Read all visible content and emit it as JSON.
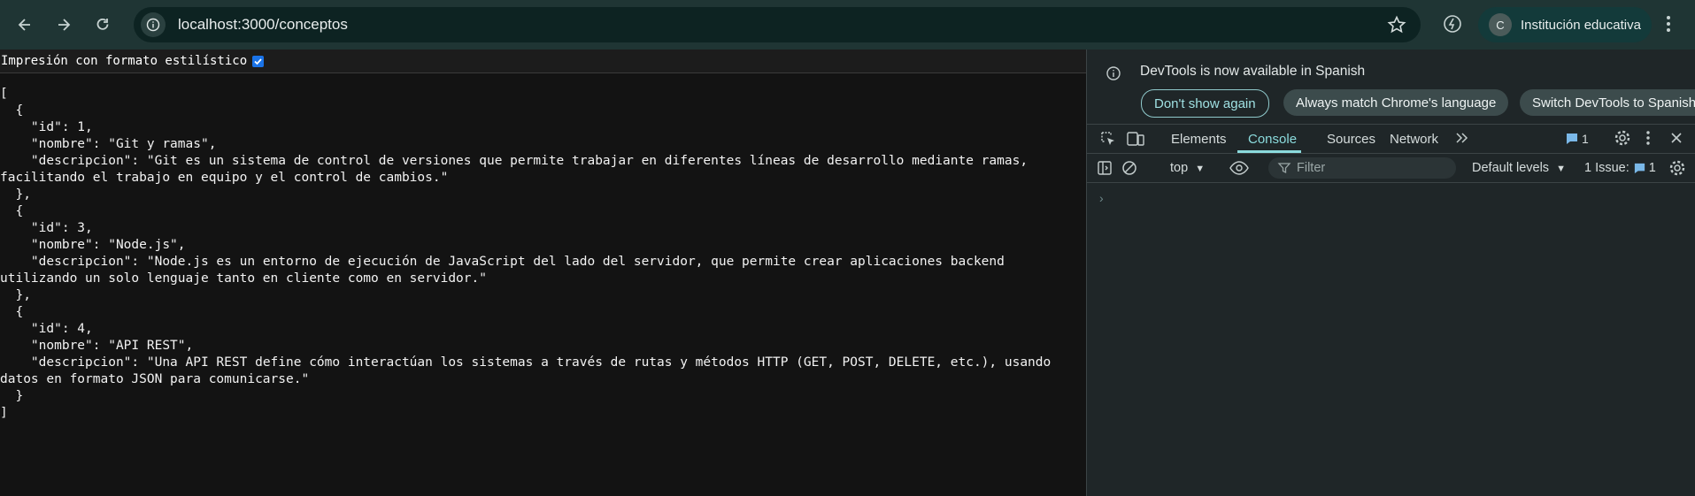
{
  "browser": {
    "url": "localhost:3000/conceptos",
    "profile_initial": "C",
    "profile_name": "Institución educativa"
  },
  "page": {
    "pretty_print_label": "Impresión con formato estilístico",
    "pretty_print_checked": true,
    "json_text": "[\n  {\n    \"id\": 1,\n    \"nombre\": \"Git y ramas\",\n    \"descripcion\": \"Git es un sistema de control de versiones que permite trabajar en diferentes líneas de desarrollo mediante ramas, facilitando el trabajo en equipo y el control de cambios.\"\n  },\n  {\n    \"id\": 3,\n    \"nombre\": \"Node.js\",\n    \"descripcion\": \"Node.js es un entorno de ejecución de JavaScript del lado del servidor, que permite crear aplicaciones backend utilizando un solo lenguaje tanto en cliente como en servidor.\"\n  },\n  {\n    \"id\": 4,\n    \"nombre\": \"API REST\",\n    \"descripcion\": \"Una API REST define cómo interactúan los sistemas a través de rutas y métodos HTTP (GET, POST, DELETE, etc.), usando datos en formato JSON para comunicarse.\"\n  }\n]"
  },
  "devtools": {
    "infobar_text": "DevTools is now available in Spanish",
    "btn_dont_show": "Don't show again",
    "btn_match_language": "Always match Chrome's language",
    "btn_switch": "Switch DevTools to Spanish",
    "tabs": [
      "Elements",
      "Console",
      "Sources",
      "Network"
    ],
    "active_tab": "Console",
    "messages_count": "1",
    "context": "top",
    "filter_placeholder": "Filter",
    "levels": "Default levels",
    "issues_label": "1 Issue:",
    "issues_count": "1",
    "prompt_symbol": "›",
    "accent_color": "#8bdbdd"
  }
}
